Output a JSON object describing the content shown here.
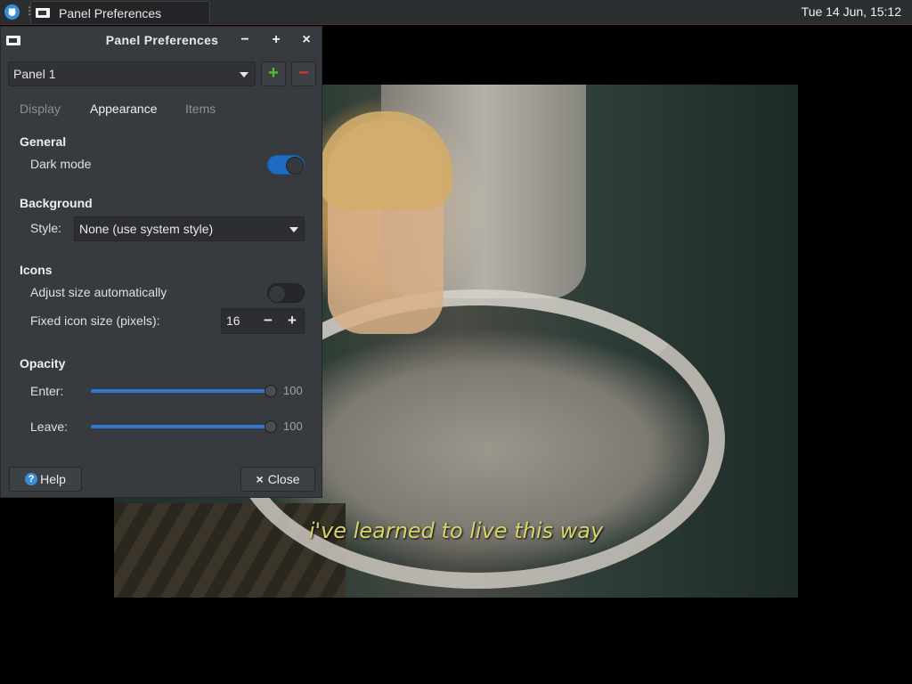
{
  "taskbar": {
    "task_title": "Panel Preferences",
    "clock": "Tue 14 Jun, 15:12"
  },
  "video": {
    "subtitle": "i've learned to live this way"
  },
  "dialog": {
    "title": "Panel Preferences",
    "panel_select": "Panel 1",
    "add_label": "+",
    "remove_label": "−",
    "tabs": [
      {
        "label": "Display",
        "active": false
      },
      {
        "label": "Appearance",
        "active": true
      },
      {
        "label": "Items",
        "active": false
      }
    ],
    "general": {
      "heading": "General",
      "dark_mode_label": "Dark mode",
      "dark_mode_on": true
    },
    "background": {
      "heading": "Background",
      "style_label": "Style:",
      "style_value": "None (use system style)"
    },
    "icons": {
      "heading": "Icons",
      "adjust_label": "Adjust size automatically",
      "adjust_on": false,
      "fixed_label": "Fixed icon size (pixels):",
      "fixed_value": "16",
      "minus": "−",
      "plus": "+"
    },
    "opacity": {
      "heading": "Opacity",
      "enter_label": "Enter:",
      "enter_value": "100",
      "leave_label": "Leave:",
      "leave_value": "100"
    },
    "help_label": "Help",
    "close_label": "Close",
    "close_glyph": "×"
  },
  "colors": {
    "accent": "#1f6bc2",
    "add_button": "#4fc12a",
    "remove_button": "#d93a3a"
  }
}
